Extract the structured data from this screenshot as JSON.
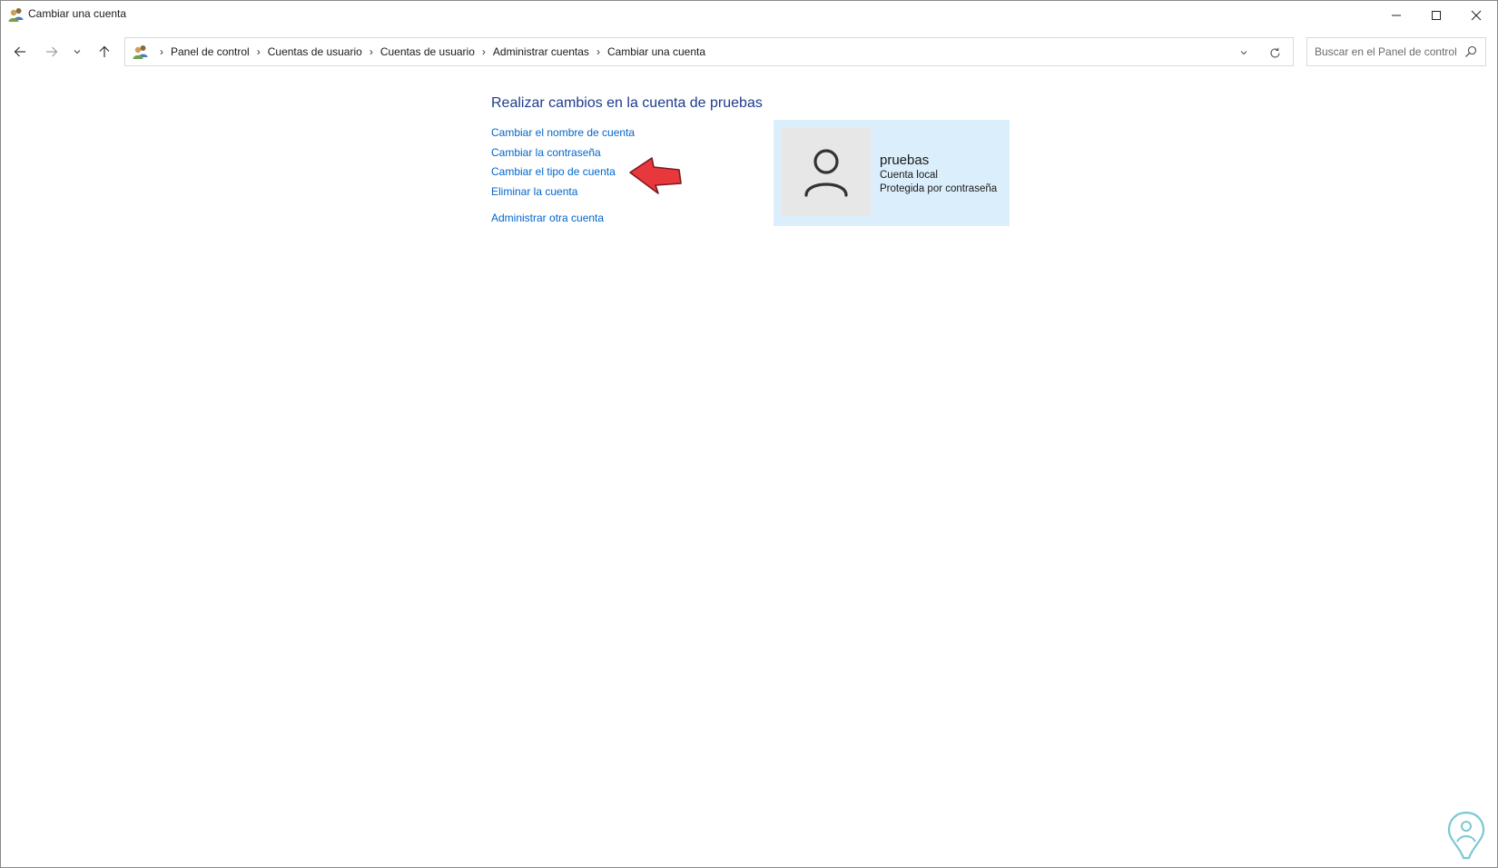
{
  "window": {
    "title": "Cambiar una cuenta"
  },
  "nav": {
    "breadcrumb": [
      "Panel de control",
      "Cuentas de usuario",
      "Cuentas de usuario",
      "Administrar cuentas",
      "Cambiar una cuenta"
    ]
  },
  "search": {
    "placeholder": "Buscar en el Panel de control",
    "value": ""
  },
  "main": {
    "heading": "Realizar cambios en la cuenta de pruebas",
    "links": {
      "rename": "Cambiar el nombre de cuenta",
      "password": "Cambiar la contraseña",
      "account_type": "Cambiar el tipo de cuenta",
      "delete": "Eliminar la cuenta",
      "manage_other": "Administrar otra cuenta"
    }
  },
  "account": {
    "name": "pruebas",
    "type": "Cuenta local",
    "status": "Protegida por contraseña"
  },
  "icons": {
    "title": "users-icon",
    "back": "arrow-left-icon",
    "forward": "arrow-right-icon",
    "recent": "chevron-down-icon",
    "up": "arrow-up-icon",
    "refresh": "refresh-icon",
    "search": "search-icon",
    "avatar": "user-icon",
    "annotation": "red-arrow-icon",
    "watermark": "logo-icon"
  },
  "colors": {
    "link": "#0066cc",
    "heading": "#1e3c8c",
    "card_background": "#dbeefb",
    "avatar_background": "#e7e7e7",
    "annotation_arrow": "#e8383d"
  }
}
